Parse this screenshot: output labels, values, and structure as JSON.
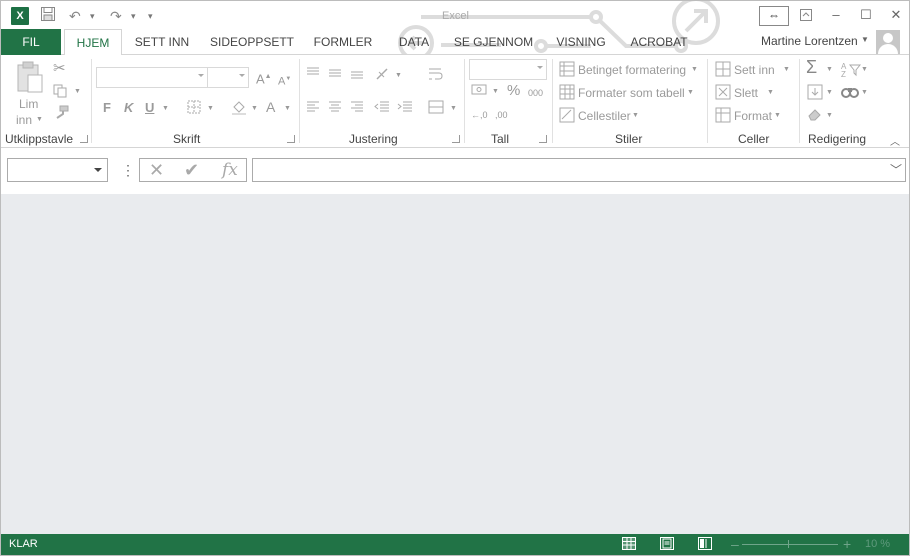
{
  "window": {
    "app_title": "Excel",
    "logo_text": "X",
    "qat": {
      "customize_glyph": "▾"
    }
  },
  "tabs": [
    {
      "label": "FIL"
    },
    {
      "label": "HJEM"
    },
    {
      "label": "SETT INN"
    },
    {
      "label": "SIDEOPPSETT"
    },
    {
      "label": "FORMLER"
    },
    {
      "label": "DATA"
    },
    {
      "label": "SE GJENNOM"
    },
    {
      "label": "VISNING"
    },
    {
      "label": "ACROBAT"
    }
  ],
  "user": {
    "name": "Martine Lorentzen"
  },
  "ribbon": {
    "groups": {
      "clipboard": "Utklippstavle",
      "font": "Skrift",
      "alignment": "Justering",
      "number": "Tall",
      "styles": "Stiler",
      "cells": "Celler",
      "editing": "Redigering"
    },
    "clipboard": {
      "paste_line1": "Lim",
      "paste_line2": "inn"
    },
    "font": {
      "bold": "F",
      "italic": "K",
      "underline": "U",
      "grow": "A",
      "shrink": "A",
      "color": "A"
    },
    "number": {
      "percent": "%",
      "thousands": "000",
      "inc_decimal": "←,0",
      "dec_decimal": ",00"
    },
    "styles": {
      "conditional": "Betinget formatering",
      "format_table": "Formater som tabell",
      "cell_styles": "Cellestiler"
    },
    "cells": {
      "insert": "Sett inn",
      "delete": "Slett",
      "format": "Format"
    },
    "editing": {
      "sum": "Σ"
    }
  },
  "formula_bar": {
    "name_box_value": "",
    "formula_value": "",
    "fx": "fx"
  },
  "status": {
    "ready": "KLAR",
    "zoom": "10 %"
  }
}
